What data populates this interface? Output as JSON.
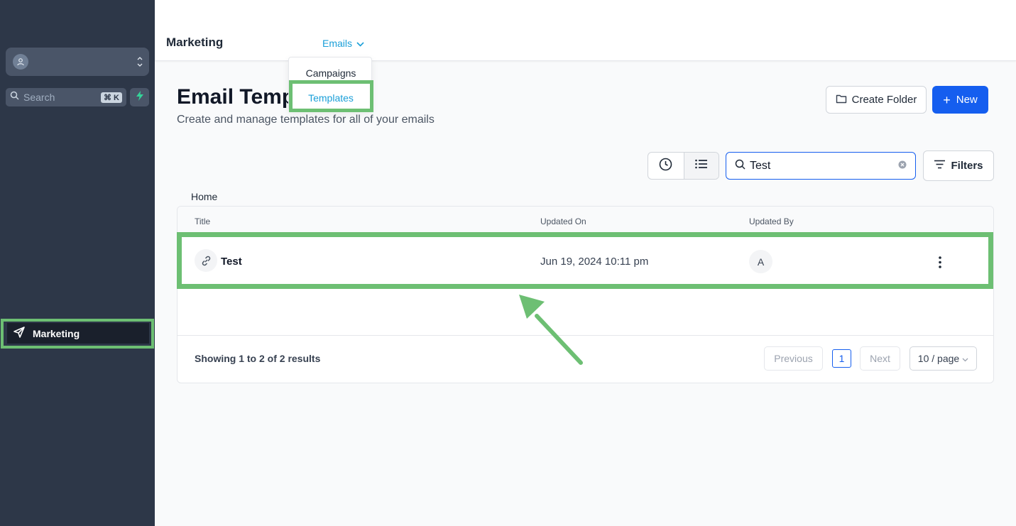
{
  "sidebar": {
    "search_placeholder": "Search",
    "search_shortcut": "⌘ K",
    "nav": {
      "marketing_label": "Marketing"
    }
  },
  "topbar": {
    "title": "Marketing",
    "menu_label": "Emails",
    "dropdown": {
      "campaigns": "Campaigns",
      "templates": "Templates"
    }
  },
  "header": {
    "title": "Email Temp",
    "subtitle": "Create and manage templates for all of your emails",
    "create_folder_label": "Create Folder",
    "new_label": "New"
  },
  "toolbar": {
    "search_value": "Test",
    "filters_label": "Filters"
  },
  "breadcrumb": "Home",
  "table": {
    "columns": [
      "Title",
      "Updated On",
      "Updated By"
    ],
    "rows": [
      {
        "title": "Test",
        "updated_on": "Jun 19, 2024 10:11 pm",
        "updated_by": "A"
      }
    ]
  },
  "pagination": {
    "results_text": "Showing 1 to 2 of 2 results",
    "previous_label": "Previous",
    "current_page": "1",
    "next_label": "Next",
    "page_size": "10 / page"
  },
  "colors": {
    "highlight": "#6dbf73",
    "accent": "#155eef",
    "link": "#1a9fd8",
    "sidebar": "#2d3748"
  }
}
